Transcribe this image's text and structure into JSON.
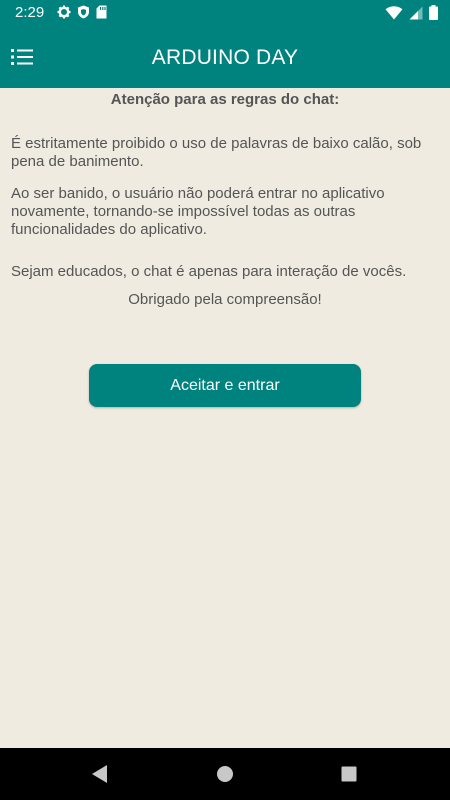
{
  "status_bar": {
    "time": "2:29",
    "icons_left": [
      "gear-icon",
      "shield-icon",
      "sd-card-icon"
    ],
    "icons_right": [
      "wifi-icon",
      "cell-signal-icon",
      "battery-icon"
    ]
  },
  "app_bar": {
    "title": "ARDUINO DAY",
    "menu_icon": "list-menu-icon"
  },
  "rules": {
    "heading": "Atenção para as regras do chat:",
    "paragraphs": [
      "É estritamente proibido o uso de palavras de baixo calão, sob pena de banimento.",
      "Ao ser banido, o usuário não poderá entrar no aplicativo novamente, tornando-se impossível todas as outras funcionalidades do aplicativo.",
      "Sejam educados, o chat é apenas para interação de vocês."
    ],
    "thanks": "Obrigado pela compreensão!"
  },
  "actions": {
    "accept_label": "Aceitar e entrar"
  },
  "nav_bar": {
    "buttons": [
      "back-icon",
      "home-icon",
      "recents-icon"
    ]
  },
  "colors": {
    "primary": "#00837f",
    "background": "#efebe1",
    "text": "#555555"
  }
}
